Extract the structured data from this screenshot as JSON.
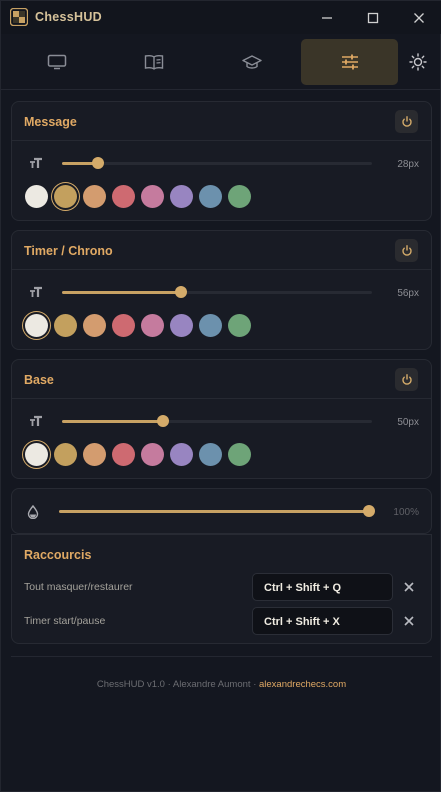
{
  "app": {
    "title": "ChessHUD"
  },
  "window_controls": [
    "minimize-icon",
    "maximize-icon",
    "close-icon"
  ],
  "tabs": [
    {
      "icon": "monitor-icon",
      "active": false
    },
    {
      "icon": "book-icon",
      "active": false
    },
    {
      "icon": "graduation-cap-icon",
      "active": false
    },
    {
      "icon": "sliders-icon",
      "active": true
    }
  ],
  "theme_toggle_icon": "sun-icon",
  "colors": {
    "accent": "#c7a163",
    "title": "#e0a964",
    "palette": [
      "#ece9e2",
      "#c3a05e",
      "#d39c6f",
      "#ce6a71",
      "#c57b9e",
      "#9885c1",
      "#6c91ad",
      "#6ea478"
    ]
  },
  "message": {
    "title": "Message",
    "size_label": "28px",
    "size_fraction": 0.115,
    "selected_color_index": 1
  },
  "timer": {
    "title": "Timer / Chrono",
    "size_label": "56px",
    "size_fraction": 0.385,
    "selected_color_index": 0
  },
  "base": {
    "title": "Base",
    "size_label": "50px",
    "size_fraction": 0.325,
    "selected_color_index": 0
  },
  "opacity": {
    "label": "100%",
    "fraction": 1.0,
    "icon": "droplet-icon"
  },
  "shortcuts": {
    "title": "Raccourcis",
    "items": [
      {
        "label": "Tout masquer/restaurer",
        "value": "Ctrl + Shift + Q"
      },
      {
        "label": "Timer start/pause",
        "value": "Ctrl + Shift + X"
      }
    ]
  },
  "footer": {
    "version": "ChessHUD v1.0",
    "author": "Alexandre Aumont",
    "link": "alexandrechecs.com",
    "separator": "·"
  }
}
